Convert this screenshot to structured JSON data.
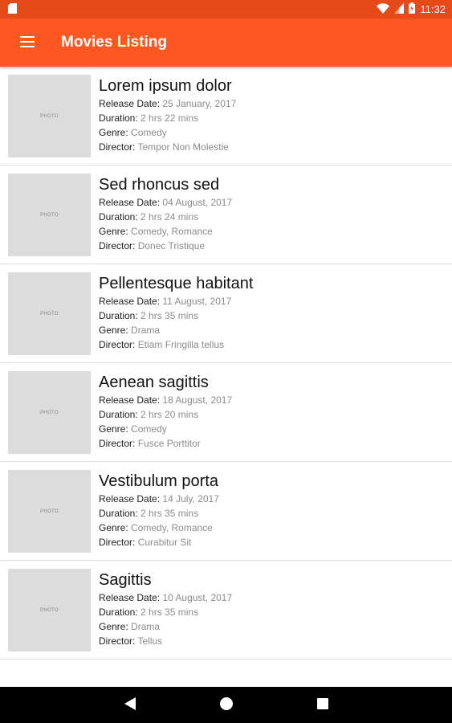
{
  "status_bar": {
    "time": "11:32",
    "icons": [
      "sd-card-icon",
      "wifi-icon",
      "signal-icon",
      "battery-charging-icon"
    ]
  },
  "app_bar": {
    "title": "Movies Listing",
    "menu_icon": "hamburger-menu-icon",
    "color": "#ff5722"
  },
  "labels": {
    "release_date": "Release Date:",
    "duration": "Duration:",
    "genre": "Genre:",
    "director": "Director:",
    "photo": "PHOTO"
  },
  "movies": [
    {
      "title": "Lorem ipsum dolor",
      "release_date": "25 January, 2017",
      "duration": "2 hrs 22 mins",
      "genre": "Comedy",
      "director": "Tempor Non Molestie"
    },
    {
      "title": "Sed rhoncus sed",
      "release_date": "04 August, 2017",
      "duration": "2 hrs 24 mins",
      "genre": "Comedy, Romance",
      "director": "Donec Tristique"
    },
    {
      "title": "Pellentesque habitant",
      "release_date": "11 August, 2017",
      "duration": "2 hrs 35 mins",
      "genre": "Drama",
      "director": "Etiam Fringilla tellus"
    },
    {
      "title": "Aenean sagittis",
      "release_date": "18 August, 2017",
      "duration": "2 hrs 20 mins",
      "genre": "Comedy",
      "director": "Fusce Porttitor"
    },
    {
      "title": "Vestibulum porta",
      "release_date": "14 July, 2017",
      "duration": "2 hrs 35 mins",
      "genre": "Comedy, Romance",
      "director": "Curabitur Sit"
    },
    {
      "title": "Sagittis",
      "release_date": "10 August, 2017",
      "duration": "2 hrs 35 mins",
      "genre": "Drama",
      "director": "Tellus"
    }
  ],
  "nav_bar": {
    "buttons": [
      "back-icon",
      "home-icon",
      "recents-icon"
    ]
  }
}
